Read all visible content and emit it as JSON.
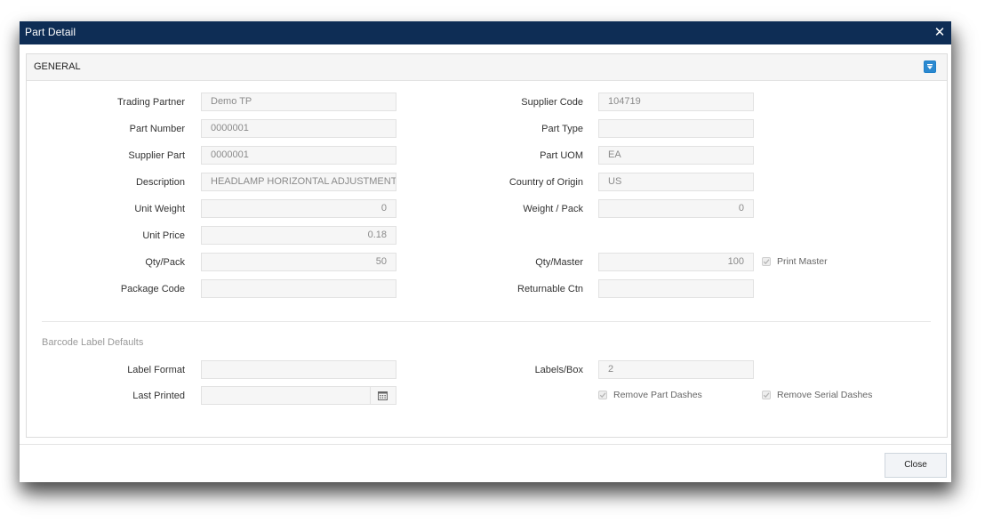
{
  "dialog": {
    "title": "Part Detail",
    "close_glyph": "✕"
  },
  "panel": {
    "title": "GENERAL",
    "collapse_icon": "chevron-down-icon"
  },
  "fields": {
    "trading_partner": {
      "label": "Trading Partner",
      "value": "Demo TP"
    },
    "part_number": {
      "label": "Part Number",
      "value": "0000001"
    },
    "supplier_part": {
      "label": "Supplier Part",
      "value": "0000001"
    },
    "description": {
      "label": "Description",
      "value": "HEADLAMP HORIZONTAL ADJUSTMENT I"
    },
    "unit_weight": {
      "label": "Unit Weight",
      "value": "0"
    },
    "unit_price": {
      "label": "Unit Price",
      "value": "0.18"
    },
    "qty_pack": {
      "label": "Qty/Pack",
      "value": "50"
    },
    "package_code": {
      "label": "Package Code",
      "value": ""
    },
    "supplier_code": {
      "label": "Supplier Code",
      "value": "104719"
    },
    "part_type": {
      "label": "Part Type",
      "value": ""
    },
    "part_uom": {
      "label": "Part UOM",
      "value": "EA"
    },
    "country_of_origin": {
      "label": "Country of Origin",
      "value": "US"
    },
    "weight_pack": {
      "label": "Weight / Pack",
      "value": "0"
    },
    "qty_master": {
      "label": "Qty/Master",
      "value": "100"
    },
    "returnable_ctn": {
      "label": "Returnable Ctn",
      "value": ""
    }
  },
  "checkboxes": {
    "print_master": {
      "label": "Print Master",
      "checked": true
    },
    "remove_part_dashes": {
      "label": "Remove Part Dashes",
      "checked": true
    },
    "remove_serial_dashes": {
      "label": "Remove Serial Dashes",
      "checked": true
    }
  },
  "barcode": {
    "section_title": "Barcode Label Defaults",
    "label_format": {
      "label": "Label Format",
      "value": ""
    },
    "last_printed": {
      "label": "Last Printed",
      "value": ""
    },
    "labels_box": {
      "label": "Labels/Box",
      "value": "2"
    }
  },
  "footer": {
    "close_label": "Close"
  },
  "colors": {
    "titlebar": "#0e2d55",
    "accent": "#2b89d0"
  }
}
